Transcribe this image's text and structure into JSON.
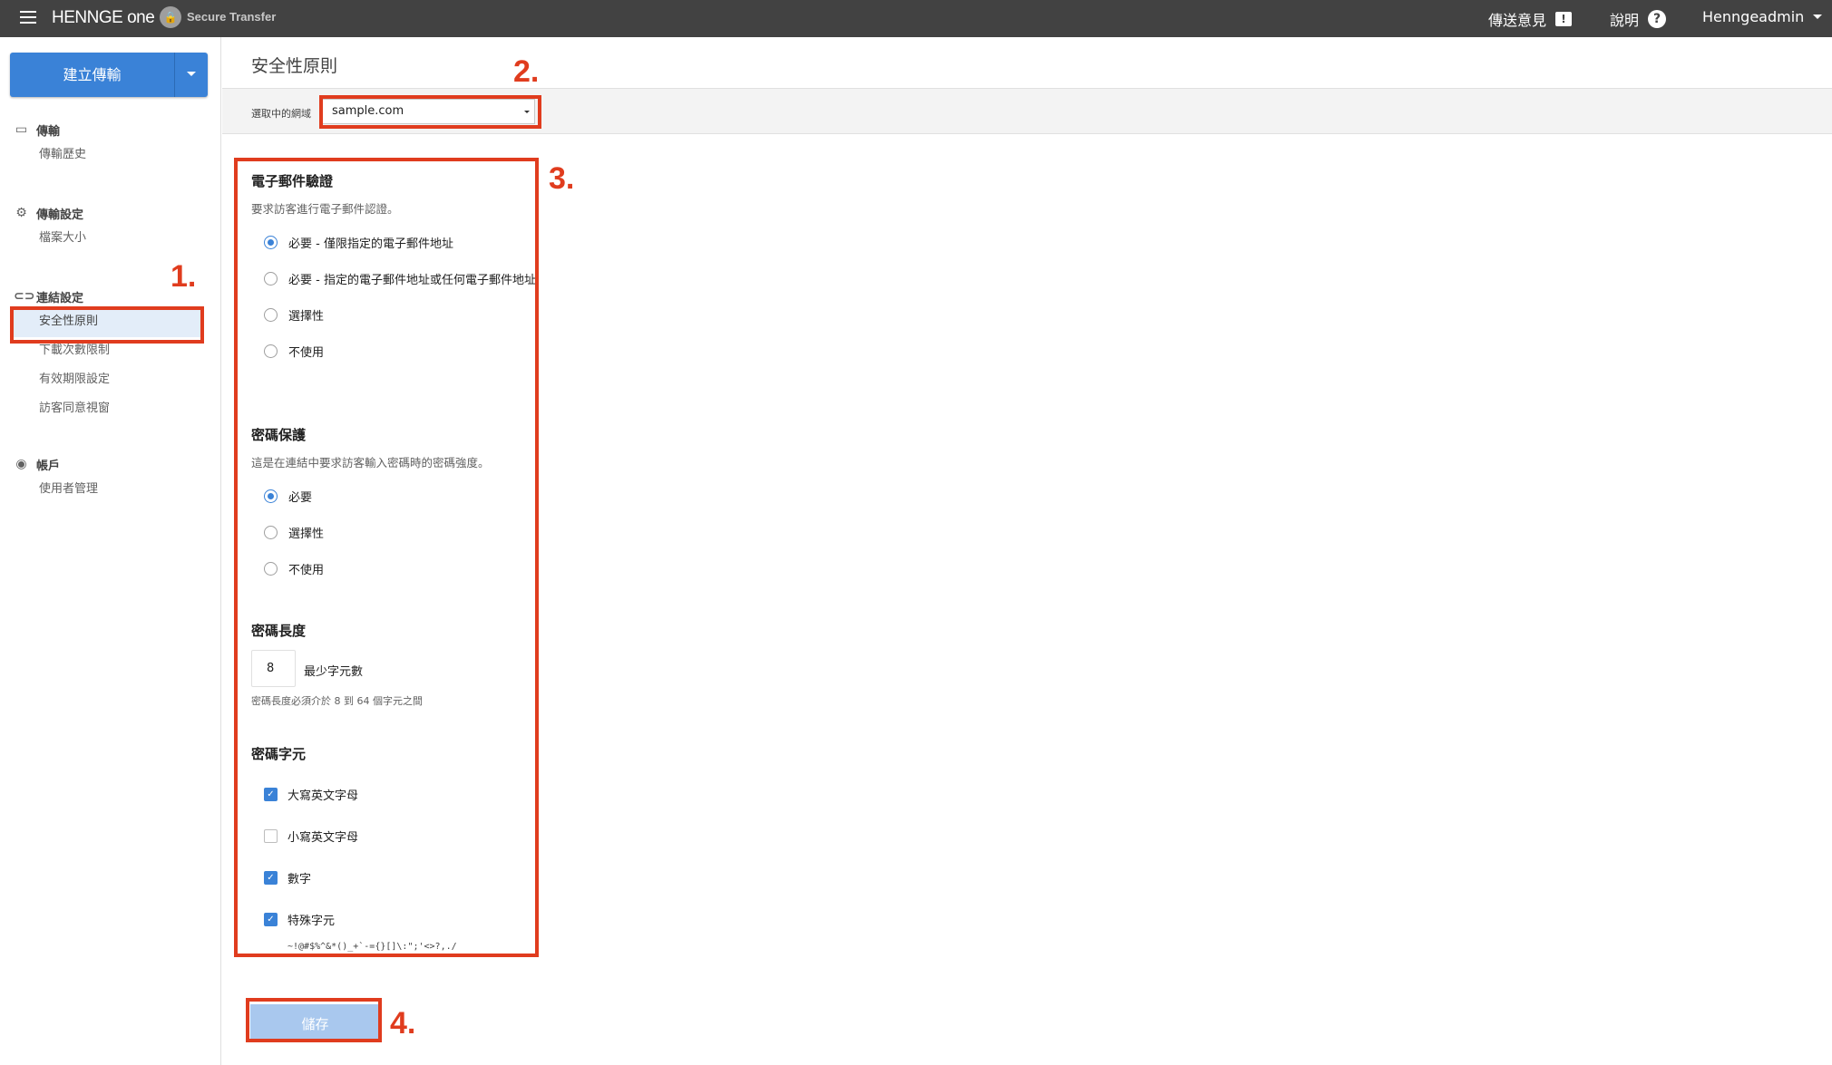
{
  "app": {
    "brand": "HENNGE one",
    "product_icon": "lock-icon",
    "product_name": "Secure Transfer"
  },
  "topbar": {
    "feedback_label": "傳送意見",
    "feedback_icon": "feedback-icon",
    "help_label": "說明",
    "help_icon": "help-icon",
    "user_label": "Henngeadmin"
  },
  "sidebar": {
    "create_button": "建立傳輸",
    "sections": [
      {
        "title": "傳輸",
        "icon": "calendar-icon",
        "items": [
          "傳輸歷史"
        ]
      },
      {
        "title": "傳輸設定",
        "icon": "gear-icon",
        "items": [
          "檔案大小"
        ]
      },
      {
        "title": "連結設定",
        "icon": "link-icon",
        "items": [
          "安全性原則",
          "下載次數限制",
          "有效期限設定",
          "訪客同意視窗"
        ]
      },
      {
        "title": "帳戶",
        "icon": "account-icon",
        "items": [
          "使用者管理"
        ]
      }
    ],
    "active_item": "安全性原則"
  },
  "main": {
    "page_title": "安全性原則",
    "domain_label": "選取中的網域",
    "domain_value": "sample.com",
    "email_verification": {
      "title": "電子郵件驗證",
      "description": "要求訪客進行電子郵件認證。",
      "options": [
        "必要 - 僅限指定的電子郵件地址",
        "必要 - 指定的電子郵件地址或任何電子郵件地址",
        "選擇性",
        "不使用"
      ],
      "selected_index": 0
    },
    "password_protection": {
      "title": "密碼保護",
      "description": "這是在連結中要求訪客輸入密碼時的密碼強度。",
      "options": [
        "必要",
        "選擇性",
        "不使用"
      ],
      "selected_index": 0
    },
    "password_length": {
      "title": "密碼長度",
      "value": "8",
      "label": "最少字元數",
      "help": "密碼長度必須介於 8 到 64 個字元之間"
    },
    "password_chars": {
      "title": "密碼字元",
      "options": [
        {
          "label": "大寫英文字母",
          "checked": true
        },
        {
          "label": "小寫英文字母",
          "checked": false
        },
        {
          "label": "數字",
          "checked": true
        },
        {
          "label": "特殊字元",
          "checked": true
        }
      ],
      "special_chars": "~!@#$%^&*()_+`-={}[]\\:\";'<>?,./"
    },
    "save_button": "儲存"
  },
  "annotations": {
    "labels": [
      "1.",
      "2.",
      "3.",
      "4."
    ],
    "color": "#e03c1e"
  },
  "colors": {
    "topbar": "#424242",
    "primary": "#3a82d7",
    "save_disabled": "#a9c8ee",
    "active_nav": "#e3edf9"
  }
}
